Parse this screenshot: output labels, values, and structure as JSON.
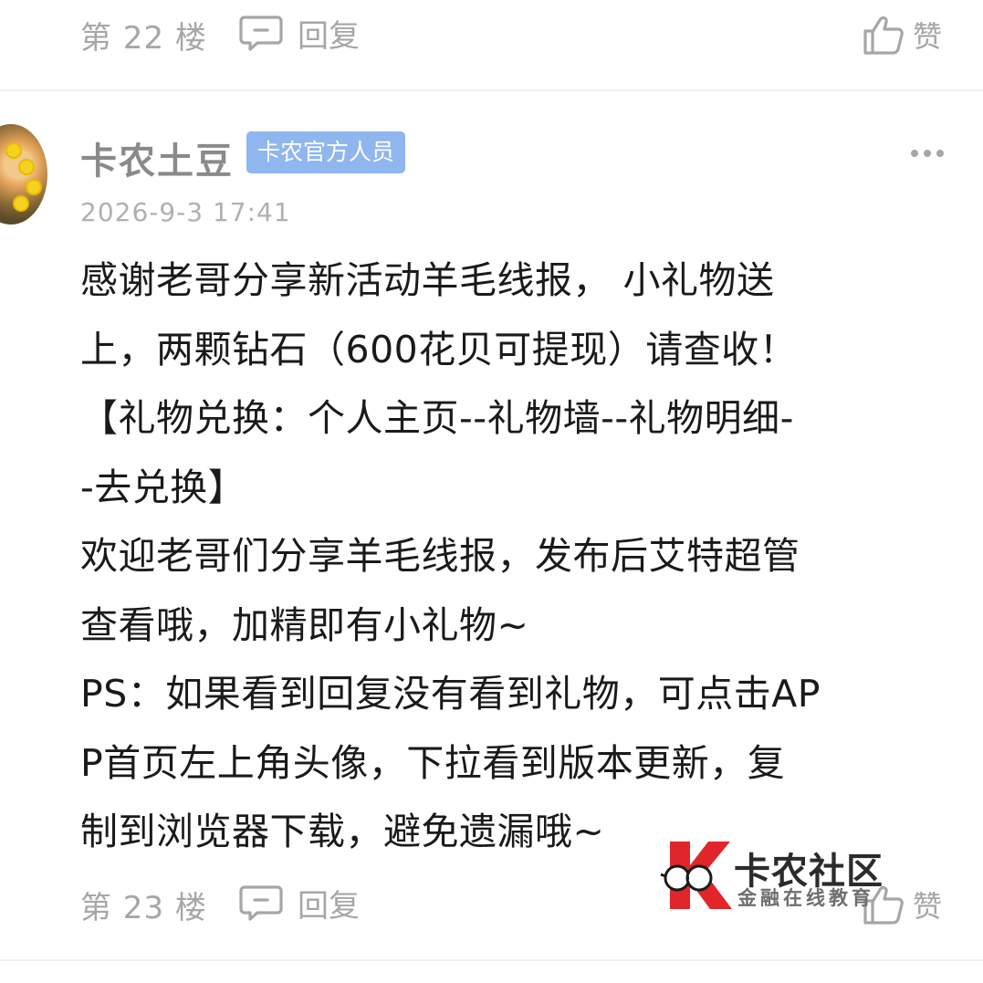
{
  "prev_floor": {
    "floor_label": "第 22 楼",
    "reply_label": "回复",
    "like_label": "赞"
  },
  "post": {
    "username": "卡农土豆",
    "badge": "卡农官方人员",
    "timestamp": "2026-9-3 17:41",
    "content_lines": [
      "感谢老哥分享新活动羊毛线报， 小礼物送",
      "上，两颗钻石（600花贝可提现）请查收！",
      "【礼物兑换：个人主页--礼物墙--礼物明细-",
      "-去兑换】",
      "欢迎老哥们分享羊毛线报，发布后艾特超管",
      "查看哦，加精即有小礼物~",
      "PS：如果看到回复没有看到礼物，可点击AP",
      "P首页左上角头像，下拉看到版本更新，复",
      "制到浏览器下载，避免遗漏哦~"
    ],
    "floor_label": "第 23 楼",
    "reply_label": "回复",
    "like_label": "赞",
    "more_icon": "more-dots-icon"
  },
  "watermark": {
    "name": "卡农社区",
    "subtitle": "金融在线教育"
  },
  "colors": {
    "muted_text": "#a6a6a6",
    "badge_bg": "#8fb6ef",
    "body_text": "#1a1a1a",
    "brand_red": "#e0262b"
  }
}
